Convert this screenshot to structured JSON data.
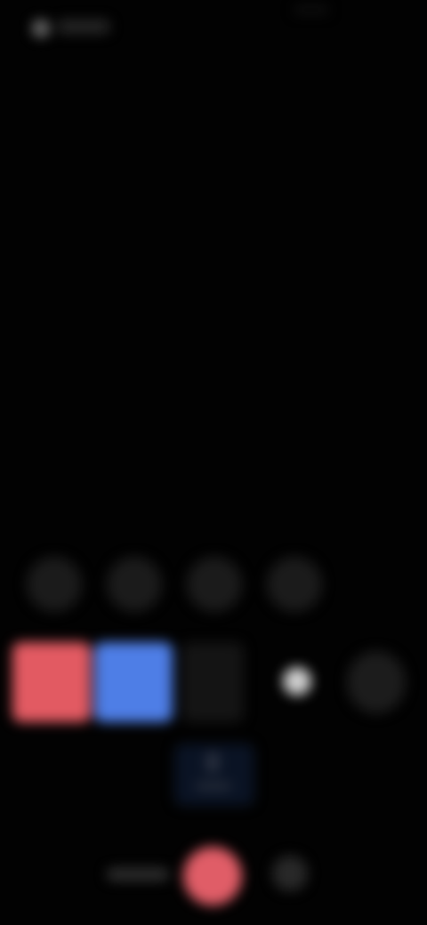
{
  "colors": {
    "background": "#020202",
    "red": "#e25a62",
    "blue": "#4e7ee6",
    "record": "#e05d67",
    "panel": "#0a1324",
    "light": "#cfcfcf"
  },
  "icons": {
    "status": "status-indicator-icon",
    "record": "record-icon",
    "options": "options-icon"
  }
}
